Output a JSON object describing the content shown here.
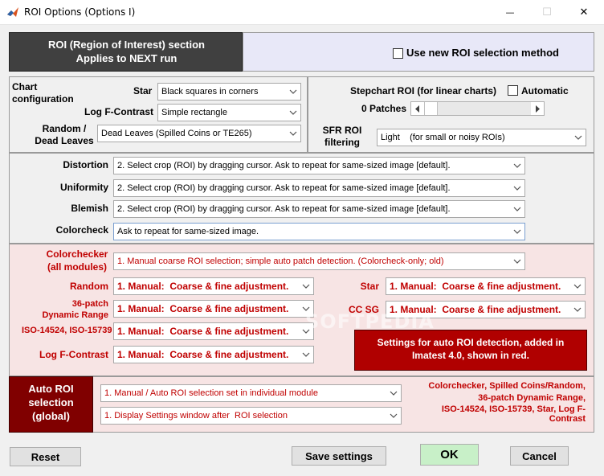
{
  "window": {
    "title": "ROI Options (Options I)",
    "minimize_glyph": "—",
    "maximize_glyph": "☐",
    "close_glyph": "✕"
  },
  "header": {
    "line1": "ROI (Region of Interest) section",
    "line2": "Applies to NEXT run",
    "new_method_checkbox_label": "Use new ROI selection method",
    "new_method_checked": false
  },
  "chart_config": {
    "title_line1": "Chart",
    "title_line2": "configuration",
    "star_label": "Star",
    "star_value": "Black squares in corners",
    "logf_label": "Log F-Contrast",
    "logf_value": "Simple rectangle",
    "random_label_line1": "Random /",
    "random_label_line2": "Dead Leaves",
    "random_value": "Dead Leaves (Spilled Coins or TE265)"
  },
  "stepchart": {
    "title": "Stepchart ROI (for linear charts)",
    "automatic_label": "Automatic",
    "automatic_checked": false,
    "patches_label": "0 Patches",
    "sfr_label_line1": "SFR ROI",
    "sfr_label_line2": "filtering",
    "sfr_value": "Light    (for small or noisy ROIs)"
  },
  "modules": {
    "distortion_label": "Distortion",
    "distortion_value": "2. Select crop (ROI) by dragging cursor. Ask to repeat for same-sized image [default].",
    "uniformity_label": "Uniformity",
    "uniformity_value": "2. Select crop (ROI) by dragging cursor. Ask to repeat for same-sized image [default].",
    "blemish_label": "Blemish",
    "blemish_value": "2. Select crop (ROI) by dragging cursor. Ask to repeat for same-sized image [default].",
    "colorcheck_label": "Colorcheck",
    "colorcheck_value": "Ask to repeat for same-sized image."
  },
  "auto_modules": {
    "colorchecker_label_line1": "Colorchecker",
    "colorchecker_label_line2": "(all modules)",
    "colorchecker_value": "1. Manual coarse ROI selection; simple auto patch detection. (Colorcheck-only; old)",
    "random_label": "Random",
    "random_value": "1. Manual:  Coarse & fine adjustment.",
    "star_label": "Star",
    "star_value": "1. Manual:  Coarse & fine adjustment.",
    "patch36_label_line1": "36-patch",
    "patch36_label_line2": "Dynamic Range",
    "patch36_value": "1. Manual:  Coarse & fine adjustment.",
    "ccsg_label": "CC SG",
    "ccsg_value": "1. Manual:  Coarse & fine adjustment.",
    "iso_label": "ISO-14524, ISO-15739",
    "iso_value": "1. Manual:  Coarse & fine adjustment.",
    "logf_label": "Log F-Contrast",
    "logf_value": "1. Manual:  Coarse & fine adjustment.",
    "info_box_line1": "Settings for auto ROI detection, added in",
    "info_box_line2": "Imatest 4.0, shown in red."
  },
  "auto_roi": {
    "label_line1": "Auto ROI",
    "label_line2": "selection",
    "label_line3": "(global)",
    "select1_value": "1. Manual / Auto ROI selection set in individual module",
    "select2_value": "1. Display Settings window after  ROI selection",
    "note_line1": "Colorchecker, Spilled Coins/Random,",
    "note_line2": "36-patch Dynamic Range,",
    "note_line3": "ISO-14524, ISO-15739, Star, Log F-Contrast"
  },
  "buttons": {
    "reset": "Reset",
    "save": "Save settings",
    "ok": "OK",
    "cancel": "Cancel"
  },
  "watermark": "SOFTPEDIA",
  "colors": {
    "dark_header": "#404040",
    "lavender": "#e8e8f8",
    "pink": "#f7e4e4",
    "dark_red": "#800000",
    "red_box": "#b00000",
    "label_red": "#c00000",
    "ok_green": "#c8f0c8"
  },
  "icons": [
    "matlab-icon",
    "checkbox-icon",
    "dropdown-arrow-icon",
    "scroll-left-icon",
    "scroll-right-icon"
  ]
}
